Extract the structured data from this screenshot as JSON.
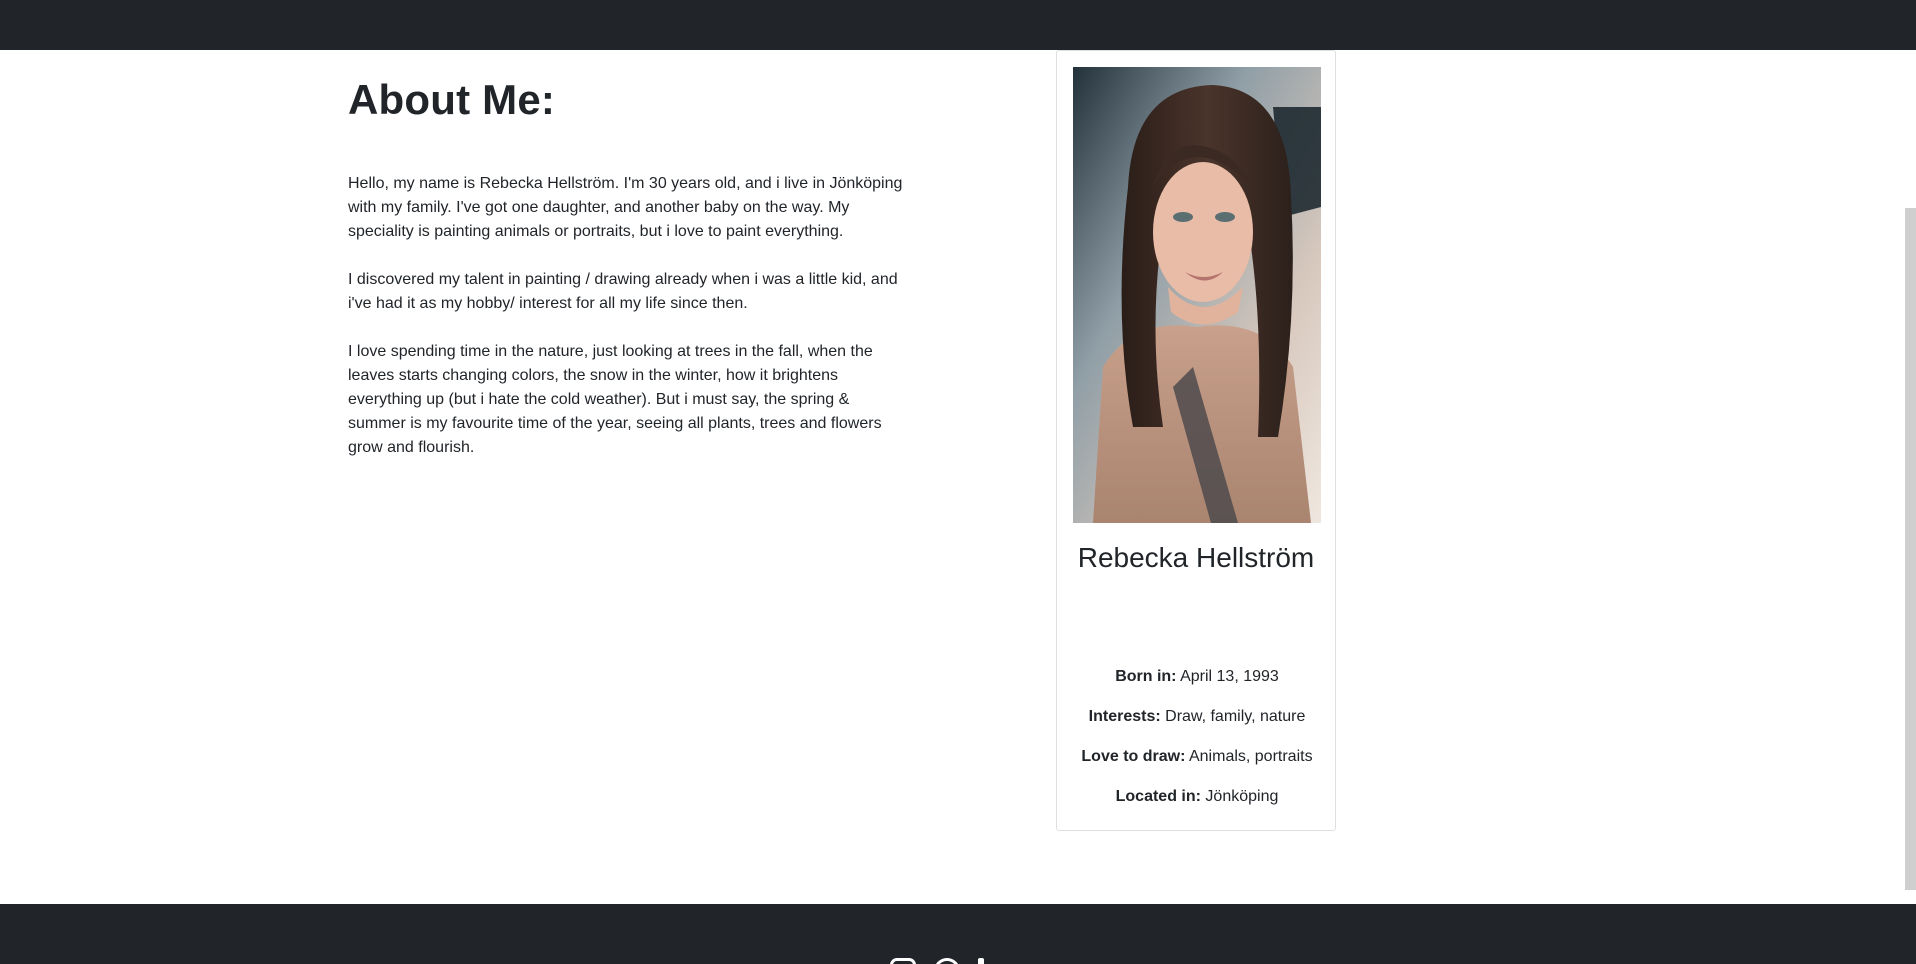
{
  "about": {
    "heading": "About Me:",
    "paragraphs": [
      "Hello, my name is Rebecka Hellström. I'm 30 years old, and i live in Jönköping with my family. I've got one daughter, and another baby on the way. My speciality is painting animals or portraits, but i love to paint everything.",
      "I discovered my talent in painting / drawing already when i was a little kid, and i've had it as my hobby/ interest for all my life since then.",
      "I love spending time in the nature, just looking at trees in the fall, when the leaves starts changing colors, the snow in the winter, how it brightens everything up (but i hate the cold weather). But i must say, the spring & summer is my favourite time of the year, seeing all plants, trees and flowers grow and flourish."
    ]
  },
  "profile": {
    "name": "Rebecka Hellström",
    "facts": [
      {
        "label": "Born in:",
        "value": "April 13, 1993"
      },
      {
        "label": "Interests:",
        "value": "Draw, family, nature"
      },
      {
        "label": "Love to draw:",
        "value": "Animals, portraits"
      },
      {
        "label": "Located in:",
        "value": "Jönköping"
      }
    ]
  },
  "footer": {
    "icons": [
      "instagram-icon",
      "pinterest-icon",
      "tiktok-icon"
    ]
  },
  "colors": {
    "dark_bar": "#212529",
    "text": "#212529",
    "card_border": "#dfdfdf"
  }
}
